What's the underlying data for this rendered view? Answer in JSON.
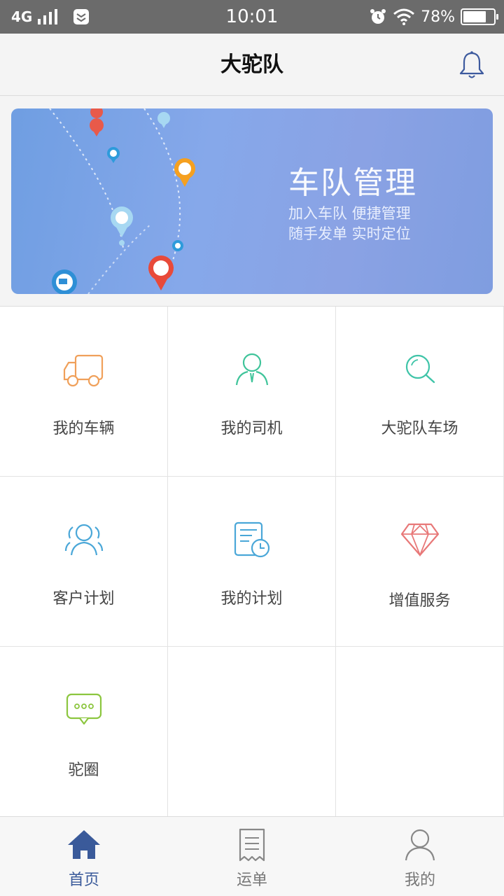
{
  "status_bar": {
    "network": "4G",
    "time": "10:01",
    "battery_text": "78%",
    "battery_level": 0.78
  },
  "header": {
    "title": "大驼队",
    "bell_icon": "bell-icon"
  },
  "banner": {
    "title": "车队管理",
    "subtitle_line1": "加入车队 便捷管理",
    "subtitle_line2": "随手发单 实时定位"
  },
  "grid": {
    "items": [
      {
        "label": "我的车辆",
        "icon": "truck-icon",
        "color": "#f0a05a"
      },
      {
        "label": "我的司机",
        "icon": "driver-icon",
        "color": "#3fc49a"
      },
      {
        "label": "大驼队车场",
        "icon": "search-icon",
        "color": "#3fc4a8"
      },
      {
        "label": "客户计划",
        "icon": "customers-icon",
        "color": "#4aa7d8"
      },
      {
        "label": "我的计划",
        "icon": "schedule-icon",
        "color": "#4aa7d8"
      },
      {
        "label": "增值服务",
        "icon": "diamond-icon",
        "color": "#e87878"
      },
      {
        "label": "驼圈",
        "icon": "chat-bubble-icon",
        "color": "#8cc63f"
      }
    ]
  },
  "bottom_nav": {
    "items": [
      {
        "label": "首页",
        "icon": "home-icon",
        "active": true
      },
      {
        "label": "运单",
        "icon": "waybill-icon",
        "active": false
      },
      {
        "label": "我的",
        "icon": "profile-icon",
        "active": false
      }
    ],
    "active_color": "#3a5a9a"
  }
}
